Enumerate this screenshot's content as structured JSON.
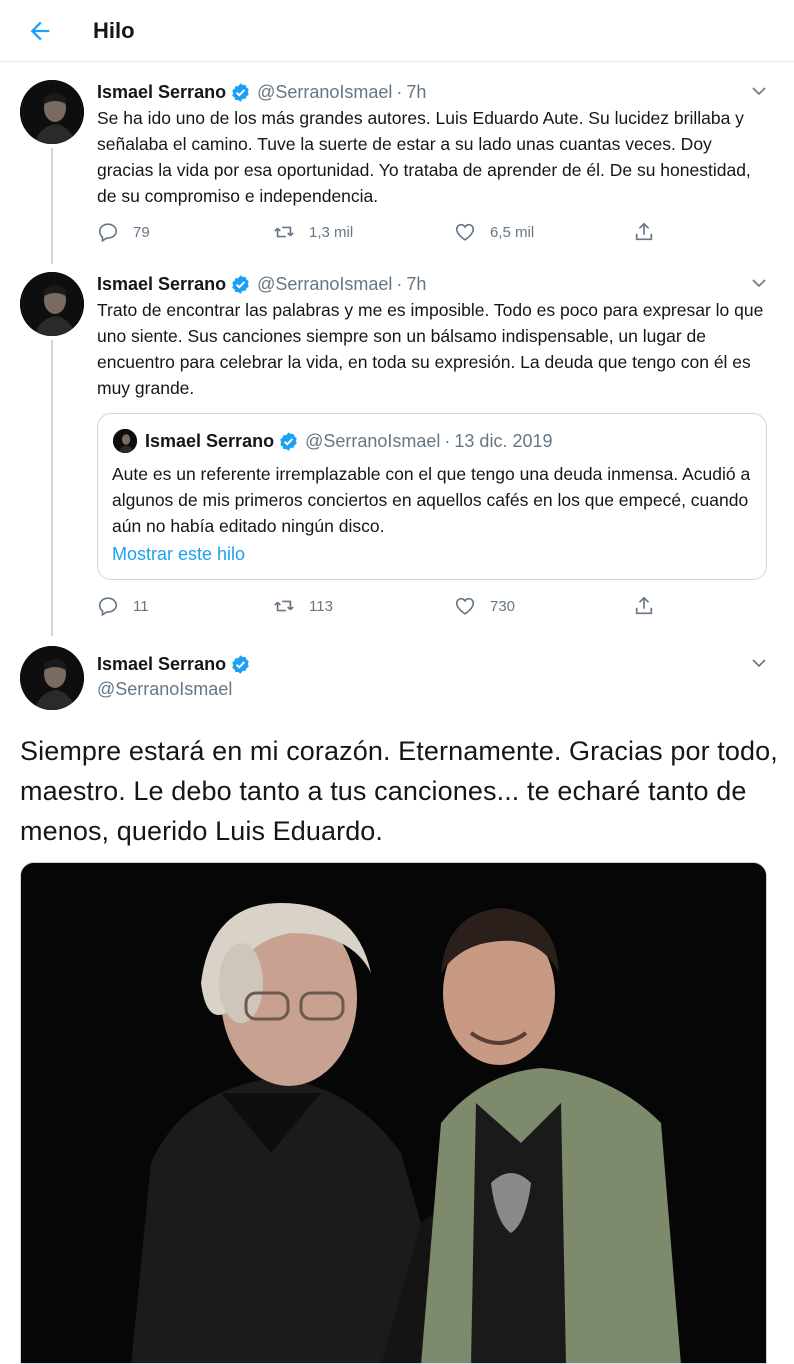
{
  "header": {
    "title": "Hilo",
    "back_icon": "arrow-left-icon"
  },
  "colors": {
    "accent": "#1da1f2",
    "text": "#14171a",
    "muted": "#657786",
    "border": "#ccd6dd"
  },
  "tweets": [
    {
      "name": "Ismael Serrano",
      "handle": "@SerranoIsmael",
      "separator": "·",
      "time": "7h",
      "text": "Se ha ido uno de los más grandes autores. Luis Eduardo Aute. Su lucidez brillaba y señalaba el camino. Tuve la suerte de estar a su lado unas cuantas veces. Doy gracias la vida por esa oportunidad. Yo trataba de aprender de él. De su honestidad, de su compromiso e independencia.",
      "replies": "79",
      "retweets": "1,3 mil",
      "likes": "6,5 mil"
    },
    {
      "name": "Ismael Serrano",
      "handle": "@SerranoIsmael",
      "separator": "·",
      "time": "7h",
      "text": "Trato de encontrar las palabras y me es imposible. Todo es poco para expresar lo que uno siente. Sus canciones siempre son un bálsamo indispensable, un lugar de encuentro para celebrar la vida, en toda su expresión. La deuda que tengo con él es muy grande.",
      "replies": "11",
      "retweets": "113",
      "likes": "730",
      "quote": {
        "name": "Ismael Serrano",
        "handle": "@SerranoIsmael",
        "separator": "·",
        "date": "13 dic. 2019",
        "text": "Aute es un referente irremplazable con el que tengo una deuda inmensa. Acudió a algunos de mis primeros conciertos en aquellos cafés en los que empecé, cuando aún no había editado ningún disco.",
        "link": "Mostrar este hilo"
      }
    }
  ],
  "main_tweet": {
    "name": "Ismael Serrano",
    "handle": "@SerranoIsmael",
    "text": "Siempre estará en mi corazón. Eternamente. Gracias por todo, maestro. Le debo tanto a tus canciones... te echaré tanto de menos, querido Luis Eduardo.",
    "photo": "photo-two-men-black-background"
  },
  "icons": [
    "reply-icon",
    "retweet-icon",
    "like-icon",
    "share-icon",
    "verified-badge-icon",
    "chevron-down-icon"
  ]
}
